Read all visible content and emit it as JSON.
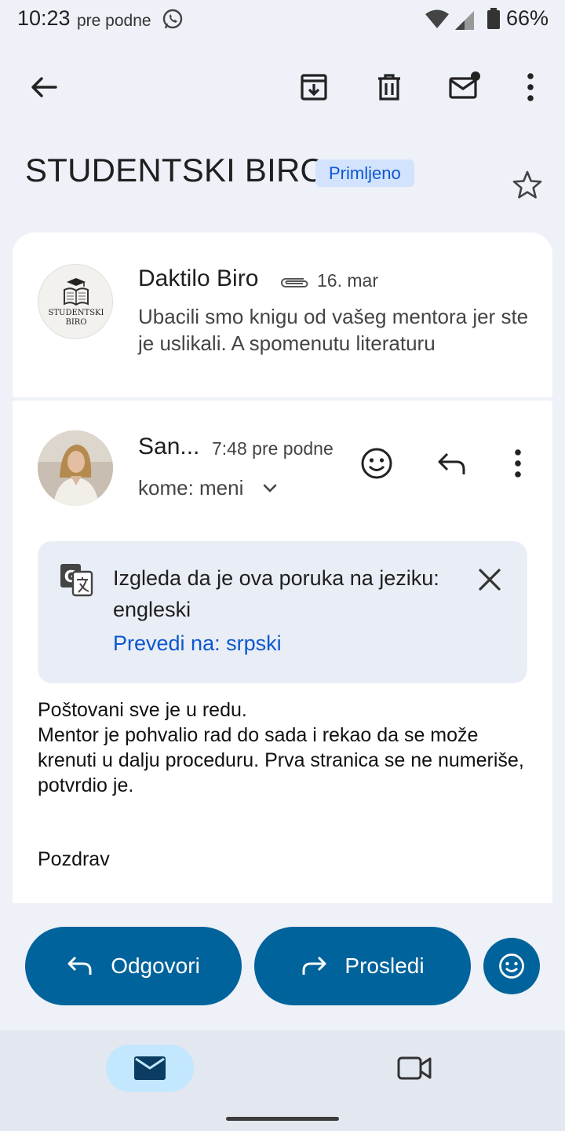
{
  "status_bar": {
    "time": "10:23",
    "ampm": "pre podne",
    "battery": "66%",
    "icons": [
      "whatsapp-icon",
      "wifi-icon",
      "signal-icon",
      "battery-icon"
    ]
  },
  "toolbar": {
    "icons": [
      "back-arrow-icon",
      "archive-icon",
      "delete-icon",
      "mark-unread-icon",
      "more-vert-icon"
    ]
  },
  "thread": {
    "subject": "STUDENTSKI BIRO",
    "label": "Primljeno",
    "starred": false
  },
  "messages": [
    {
      "sender": "Daktilo Biro",
      "date": "16. mar",
      "has_attachment": true,
      "snippet": "Ubacili smo knigu od vašeg mentora jer ste je uslikali. A spomenutu literaturu",
      "avatar_text_line1": "STUDENTSKI",
      "avatar_text_line2": "BIRO"
    },
    {
      "sender": "San...",
      "time": "7:48 pre podne",
      "recipient": "kome: meni",
      "translate": {
        "message": "Izgleda da je ova poruka na jeziku: engleski",
        "link": "Prevedi na: srpski"
      },
      "body": "Poštovani sve je u redu.\nMentor je pohvalio rad do sada i rekao da se može krenuti u dalju proceduru. Prva stranica se ne numeriše, potvrdio je.",
      "signoff": "Pozdrav"
    }
  ],
  "actions": {
    "reply": "Odgovori",
    "forward": "Prosledi"
  },
  "colors": {
    "accent": "#00639b",
    "chip_bg": "#d3e3fd",
    "link": "#0b57d0",
    "background": "#eef1f7"
  }
}
